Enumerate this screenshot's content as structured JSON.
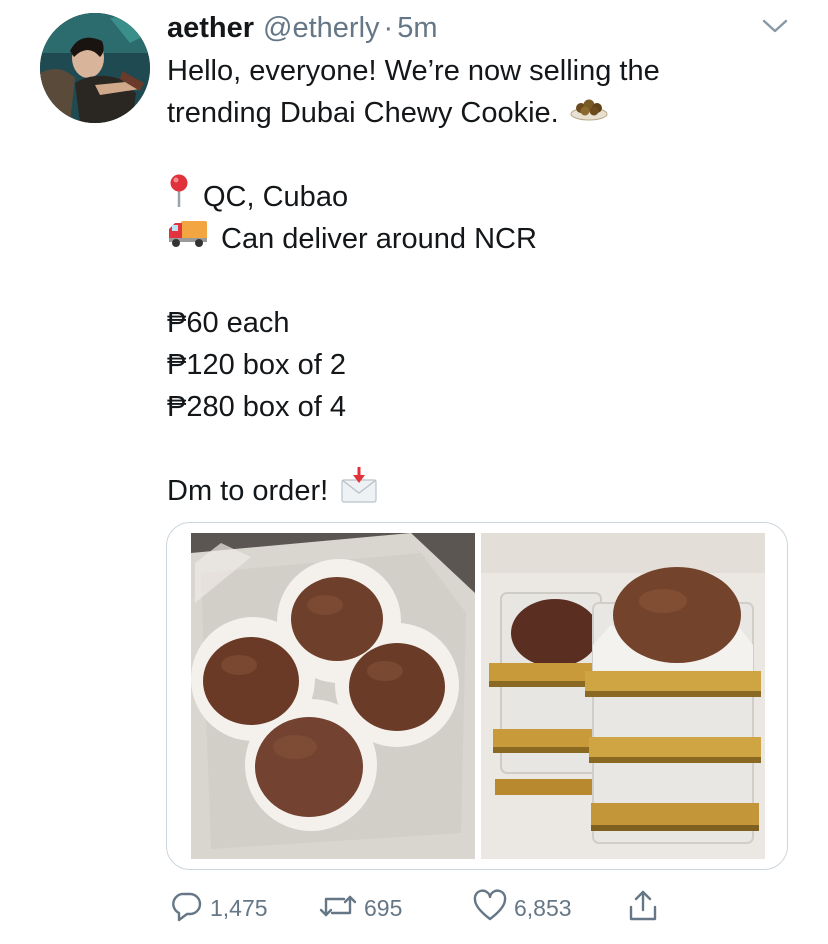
{
  "tweet": {
    "author": {
      "display_name": "aether",
      "handle": "@etherly",
      "separator": "·",
      "time": "5m"
    },
    "lines": [
      {
        "text": "Hello, everyone! We’re now selling the",
        "emoji": ""
      },
      {
        "text": "trending Dubai Chewy Cookie.",
        "emoji": "cookie-plate"
      },
      {
        "text": "",
        "emoji": ""
      },
      {
        "text": "QC, Cubao",
        "emoji": "round-pushpin"
      },
      {
        "text": "Can deliver around NCR",
        "emoji": "delivery-truck"
      },
      {
        "text": "",
        "emoji": ""
      },
      {
        "text": "₱60 each",
        "emoji": ""
      },
      {
        "text": "₱120 box of 2",
        "emoji": ""
      },
      {
        "text": "₱280 box of 4",
        "emoji": ""
      },
      {
        "text": "",
        "emoji": ""
      },
      {
        "text": "Dm to order!",
        "emoji": "incoming-envelope"
      }
    ],
    "media": [
      {
        "description": "four cookies in paper cups in a plastic container"
      },
      {
        "description": "stacked boxed cookies with gold bases"
      }
    ],
    "actions": {
      "reply_count": "1,475",
      "retweet_count": "695",
      "like_count": "6,853"
    },
    "icons": {
      "reply": "reply-icon",
      "retweet": "retweet-icon",
      "like": "heart-icon",
      "share": "share-icon",
      "more": "chevron-down-icon"
    },
    "colors": {
      "text": "#14171a",
      "secondary": "#657786",
      "border": "#ccd6dd"
    }
  }
}
